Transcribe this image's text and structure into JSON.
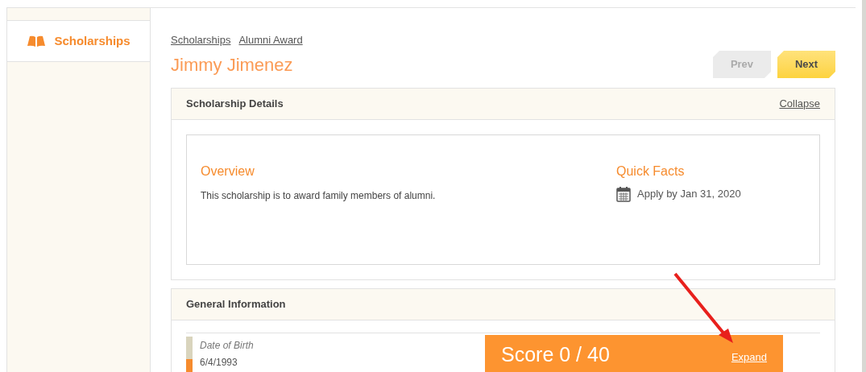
{
  "sidebar": {
    "items": [
      {
        "label": "Scholarships",
        "selected": true
      }
    ]
  },
  "breadcrumbs": [
    "Scholarships",
    "Alumni Award"
  ],
  "title": "Jimmy Jimenez",
  "nav_buttons": [
    {
      "label": "Prev",
      "disabled": true
    },
    {
      "label": "Next",
      "disabled": false
    }
  ],
  "details_panel": {
    "title": "Scholarship Details",
    "toggle": "Collapse",
    "overview": {
      "heading": "Overview",
      "text": "This scholarship is to award family members of alumni."
    },
    "quick_facts": {
      "heading": "Quick Facts",
      "items": [
        "Apply by Jan 31, 2020"
      ]
    }
  },
  "general_panel": {
    "title": "General Information",
    "fields": [
      {
        "label": "Date of Birth",
        "value": "6/4/1993"
      }
    ]
  },
  "score_bar": {
    "text": "Score 0 / 40",
    "link": "Expand"
  }
}
